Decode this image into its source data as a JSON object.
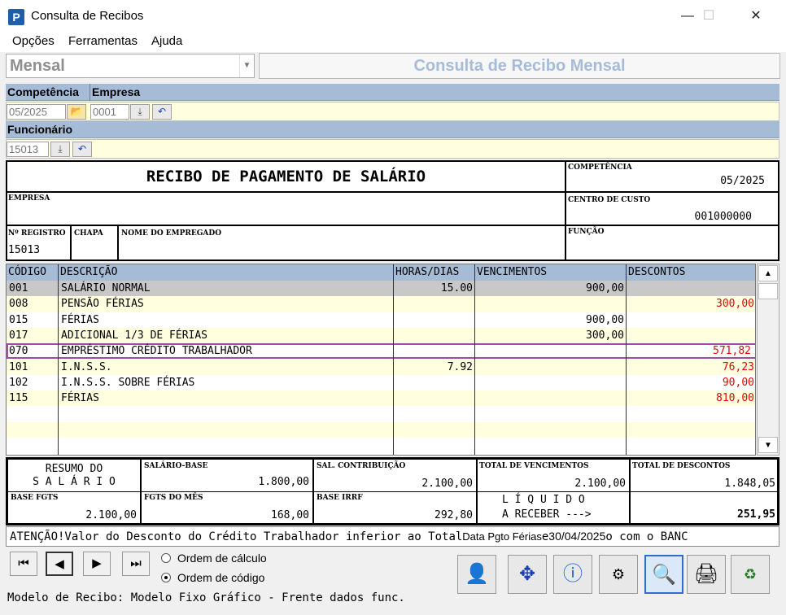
{
  "window": {
    "title": "Consulta de Recibos",
    "app_icon": "P",
    "minimize": "—",
    "maximize": "☐",
    "close": "✕"
  },
  "menu": [
    "Opções",
    "Ferramentas",
    "Ajuda"
  ],
  "mode_select": {
    "value": "Mensal"
  },
  "headline": "Consulta de Recibo Mensal",
  "filters": {
    "competencia_label": "Competência",
    "empresa_label": "Empresa",
    "competencia_value": "05/2025",
    "empresa_value": "0001",
    "funcionario_label": "Funcionário",
    "funcionario_value": "15013"
  },
  "receipt": {
    "title": "RECIBO DE PAGAMENTO DE SALÁRIO",
    "competencia_label": "COMPETÊNCIA",
    "competencia_value": "05/2025",
    "empresa_label": "EMPRESA",
    "centro_label": "CENTRO DE CUSTO",
    "centro_value": "001000000",
    "registro_label": "Nº REGISTRO",
    "registro_value": "15013",
    "chapa_label": "CHAPA",
    "nome_label": "NOME DO EMPREGADO",
    "funcao_label": "FUNÇÃO"
  },
  "grid": {
    "headers": [
      "CÓDIGO",
      "DESCRIÇÃO",
      "HORAS/DIAS",
      "VENCIMENTOS",
      "DESCONTOS"
    ],
    "rows": [
      {
        "codigo": "001",
        "descricao": "SALÁRIO NORMAL",
        "horas": "15.00",
        "venc": "900,00",
        "desc": ""
      },
      {
        "codigo": "008",
        "descricao": "PENSÃO FÉRIAS",
        "horas": "",
        "venc": "",
        "desc": "300,00"
      },
      {
        "codigo": "015",
        "descricao": "FÉRIAS",
        "horas": "",
        "venc": "900,00",
        "desc": ""
      },
      {
        "codigo": "017",
        "descricao": "ADICIONAL 1/3 DE FÉRIAS",
        "horas": "",
        "venc": "300,00",
        "desc": ""
      },
      {
        "codigo": "070",
        "descricao": "EMPRÉSTIMO CRÉDITO TRABALHADOR",
        "horas": "",
        "venc": "",
        "desc": "571,82"
      },
      {
        "codigo": "101",
        "descricao": "I.N.S.S.",
        "horas": "7.92",
        "venc": "",
        "desc": "76,23"
      },
      {
        "codigo": "102",
        "descricao": "I.N.S.S. SOBRE FÉRIAS",
        "horas": "",
        "venc": "",
        "desc": "90,00"
      },
      {
        "codigo": "115",
        "descricao": "FÉRIAS",
        "horas": "",
        "venc": "",
        "desc": "810,00"
      }
    ]
  },
  "summary": {
    "resumo_line1": "RESUMO DO",
    "resumo_line2": "S A L Á R I O",
    "salario_base_label": "SALÁRIO-BASE",
    "salario_base_value": "1.800,00",
    "sal_contrib_label": "SAL. CONTRIBUIÇÃO",
    "sal_contrib_value": "2.100,00",
    "total_venc_label": "TOTAL DE VENCIMENTOS",
    "total_venc_value": "2.100,00",
    "total_desc_label": "TOTAL DE DESCONTOS",
    "total_desc_value": "1.848,05",
    "base_fgts_label": "BASE FGTS",
    "base_fgts_value": "2.100,00",
    "fgts_mes_label": "FGTS DO MÊS",
    "fgts_mes_value": "168,00",
    "base_irrf_label": "BASE IRRF",
    "base_irrf_value": "292,80",
    "liquido_line1": "L Í Q U I D O",
    "liquido_line2": "A RECEBER --->",
    "liquido_value": "251,95"
  },
  "attention": {
    "part1": "ATENÇÃO!Valor do Desconto do Crédito Trabalhador inferior ao Total",
    "overlay_label": "Data Pgto Férias",
    "mid": "e",
    "overlay_date": "30/04/2025",
    "part2": "o com o BANC"
  },
  "nav": [
    "⏮",
    "◀",
    "▶",
    "⏭"
  ],
  "order": {
    "option1": "Ordem de cálculo",
    "option2": "Ordem de código"
  },
  "footer": "Modelo de Recibo: Modelo Fixo Gráfico - Frente dados func."
}
